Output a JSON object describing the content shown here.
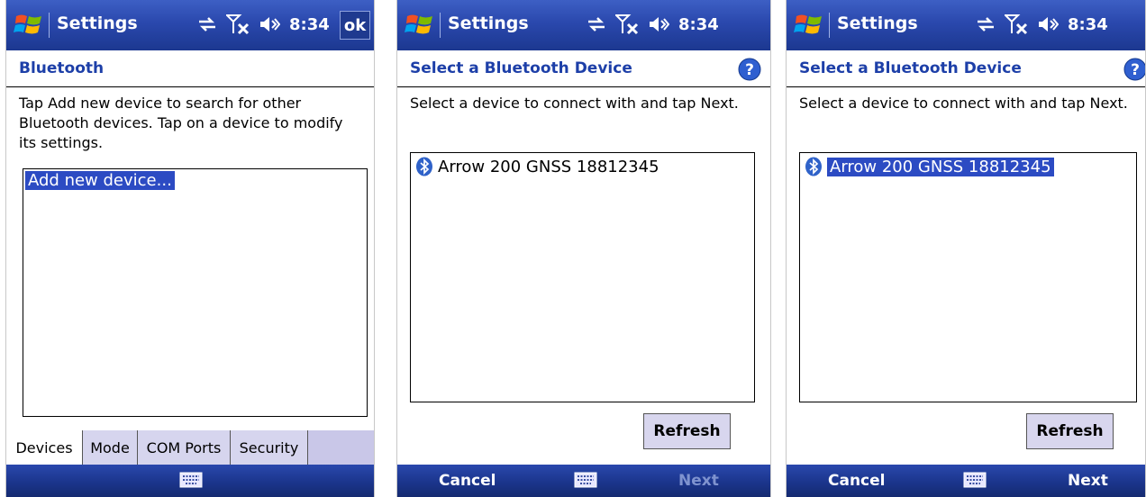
{
  "screens": [
    {
      "title": "Settings",
      "time": "8:34",
      "ok_label": "ok",
      "header": "Bluetooth",
      "instructions": "Tap Add new device to search for other Bluetooth devices. Tap on a device to modify its settings.",
      "list_item": "Add new device...",
      "tabs": [
        "Devices",
        "Mode",
        "COM Ports",
        "Security"
      ],
      "active_tab": "Devices"
    },
    {
      "title": "Settings",
      "time": "8:34",
      "header": "Select a Bluetooth Device",
      "instructions": "Select a device to connect with and tap Next.",
      "device": "Arrow 200 GNSS 18812345",
      "refresh_label": "Refresh",
      "left_softkey": "Cancel",
      "right_softkey": "Next",
      "right_softkey_enabled": false
    },
    {
      "title": "Settings",
      "time": "8:34",
      "header": "Select a Bluetooth Device",
      "instructions": "Select a device to connect with and tap Next.",
      "device": "Arrow 200 GNSS 18812345",
      "device_selected": true,
      "refresh_label": "Refresh",
      "left_softkey": "Cancel",
      "right_softkey": "Next",
      "right_softkey_enabled": true
    }
  ],
  "icons": {
    "start": "windows-logo-icon",
    "connectivity": "sync-arrows-icon",
    "signal": "no-signal-icon",
    "volume": "speaker-icon",
    "help": "help-icon",
    "bluetooth": "bluetooth-icon",
    "keyboard": "keyboard-icon"
  },
  "colors": {
    "titlebar": "#2a48ad",
    "header_text": "#1d3fa8",
    "selection": "#2c4bc3",
    "button": "#d8d6ee"
  }
}
